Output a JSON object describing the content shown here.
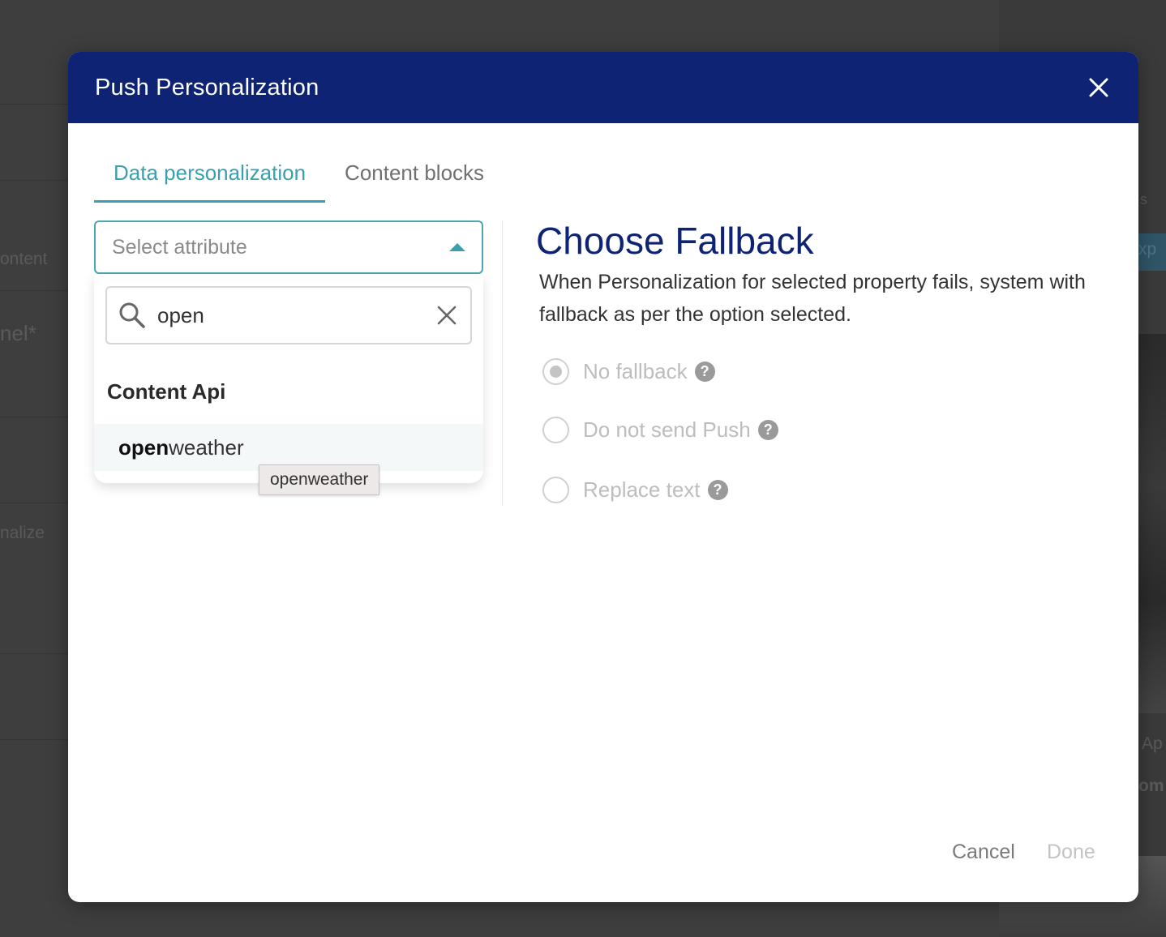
{
  "background": {
    "fragments": [
      "ontent",
      "nel*",
      "nalize",
      "xp",
      "Ap",
      "om",
      "s"
    ]
  },
  "modal": {
    "title": "Push Personalization",
    "close_icon": "close-icon",
    "tabs": [
      {
        "label": "Data personalization",
        "active": true
      },
      {
        "label": "Content blocks",
        "active": false
      }
    ]
  },
  "attribute_select": {
    "placeholder": "Select attribute",
    "search": {
      "value": "open",
      "icon": "search-icon",
      "clear_icon": "clear-icon"
    },
    "group_label": "Content Api",
    "options": [
      {
        "match": "open",
        "rest": "weather",
        "full": "openweather"
      }
    ],
    "tooltip": "openweather"
  },
  "fallback": {
    "title": "Choose Fallback",
    "description": "When Personalization for selected property fails, system with fallback as per the option selected.",
    "options": [
      {
        "label": "No fallback",
        "checked": true,
        "help": "?"
      },
      {
        "label": "Do not send Push",
        "checked": false,
        "help": "?"
      },
      {
        "label": "Replace text",
        "checked": false,
        "help": "?"
      }
    ]
  },
  "footer": {
    "cancel_label": "Cancel",
    "done_label": "Done"
  },
  "colors": {
    "header": "#0e2373",
    "accent": "#3a9fae",
    "title": "#0e2373"
  }
}
